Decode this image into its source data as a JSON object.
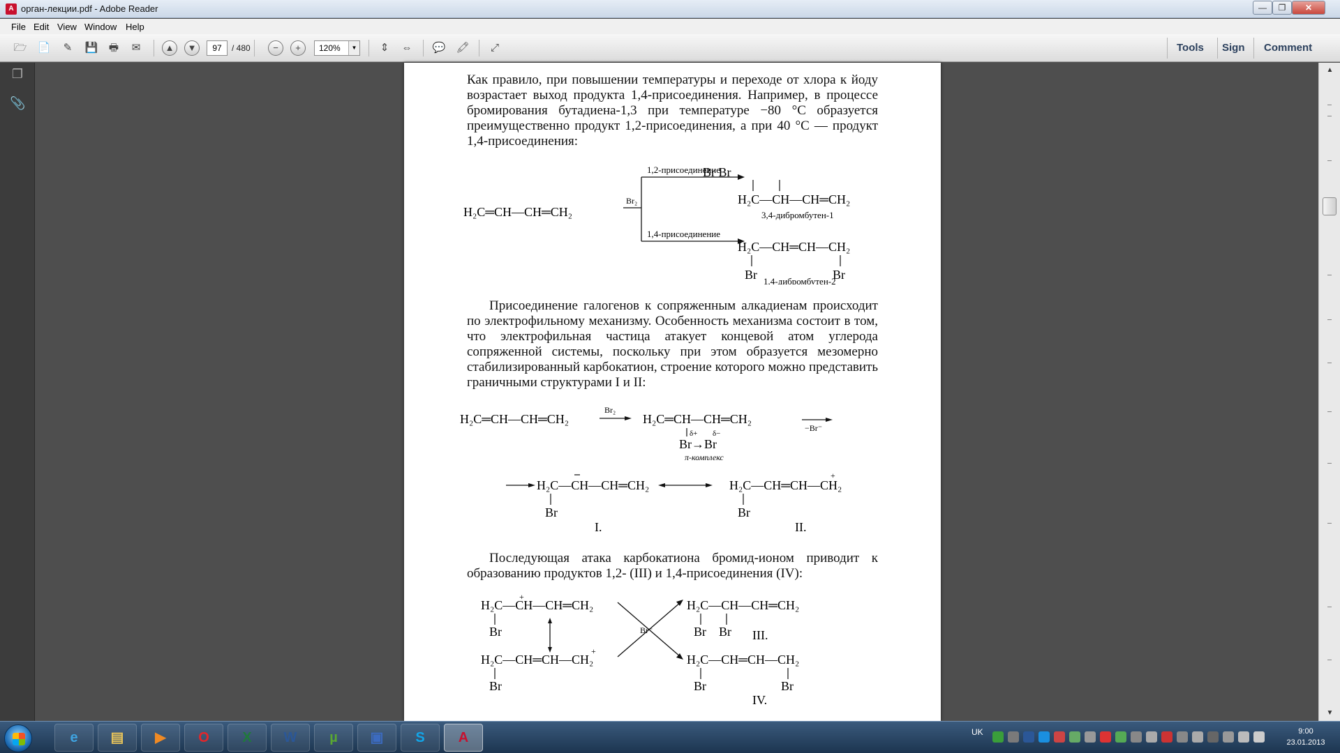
{
  "window": {
    "title": "орган-лекции.pdf - Adobe Reader",
    "icon_letter": "A",
    "min": "—",
    "max": "❐",
    "close": "✕"
  },
  "menu": [
    "File",
    "Edit",
    "View",
    "Window",
    "Help"
  ],
  "toolbar": {
    "page_current": "97",
    "page_total": "/ 480",
    "zoom": "120%",
    "tools": "Tools",
    "sign": "Sign",
    "comment": "Comment"
  },
  "document": {
    "para1": "Как правило, при повышении температуры и переходе от хлора к йоду возрастает выход продукта 1,4-присоединения. Например, в процессе бромирования бутадиена-1,3 при температуре −80 °С образуется преимущественно продукт 1,2-присоединения, а при 40 °С — продукт 1,4-присоединения:",
    "scheme1": {
      "reactant": "H₂C═CH—CH═CH₂",
      "reagent": "Br₂",
      "path1_label": "1,2-присоединение",
      "path2_label": "1,4-присоединение",
      "product1_top": "Br  Br",
      "product1": "H₂C—CH—CH═CH₂",
      "product1_name": "3,4-дибромбутен-1",
      "product2": "H₂C—CH═CH—CH₂",
      "product2_br_left": "Br",
      "product2_br_right": "Br",
      "product2_name": "1,4-дибромбутен-2"
    },
    "para2": "Присоединение галогенов к сопряженным алкадиенам происходит по электрофильному механизму. Особенность механизма состоит в том, что электрофильная частица атакует концевой атом углерода сопряженной системы, поскольку при этом образуется мезомерно стабилизированный карбокатион, строение которого можно представить граничными структурами I и II:",
    "scheme2": {
      "reactant": "H₂C═CH—CH═CH₂",
      "reagent": "Br₂",
      "pi_complex": "H₂C═CH—CH═CH₂",
      "pi_complex_br": "Br→Br",
      "delta_plus": "δ+",
      "delta_minus": "δ−",
      "pi_label": "π-комплекс",
      "minus_br": "−Br⁻",
      "structure1": "H₂C—CH—CH═CH₂",
      "structure1_br": "Br",
      "structure1_label": "I.",
      "structure2": "H₂C—CH═CH—CH₂",
      "structure2_br": "Br",
      "structure2_label": "II."
    },
    "para3": "Последующая атака карбокатиона бромид-ионом приводит к образованию продуктов 1,2- (III) и 1,4-присоединения (IV):",
    "scheme3": {
      "cation_top": "H₂C—CH—CH═CH₂",
      "cation_top_br": "Br",
      "cation_bottom": "H₂C—CH═CH—CH₂",
      "cation_bottom_br": "Br",
      "reagent": "Br⁻",
      "product3": "H₂C—CH—CH═CH₂",
      "product3_br1": "Br",
      "product3_br2": "Br",
      "product3_label": "III.",
      "product4": "H₂C—CH═CH—CH₂",
      "product4_br1": "Br",
      "product4_br2": "Br",
      "product4_label": "IV."
    }
  },
  "taskbar": {
    "apps": [
      {
        "name": "ie",
        "glyph": "e",
        "color": "#3fa3e0"
      },
      {
        "name": "explorer",
        "glyph": "▤",
        "color": "#e8c45a"
      },
      {
        "name": "media-player",
        "glyph": "▶",
        "color": "#f08a24"
      },
      {
        "name": "opera",
        "glyph": "O",
        "color": "#e3262a"
      },
      {
        "name": "excel",
        "glyph": "X",
        "color": "#1f7a3a"
      },
      {
        "name": "word",
        "glyph": "W",
        "color": "#2b5797"
      },
      {
        "name": "utorrent",
        "glyph": "µ",
        "color": "#5aa832"
      },
      {
        "name": "save",
        "glyph": "▣",
        "color": "#3c6bc0"
      },
      {
        "name": "skype",
        "glyph": "S",
        "color": "#12a5e8"
      },
      {
        "name": "adobe-reader",
        "glyph": "A",
        "color": "#c8102e"
      }
    ],
    "lang": "UK",
    "time": "9:00",
    "date": "23.01.2013"
  }
}
